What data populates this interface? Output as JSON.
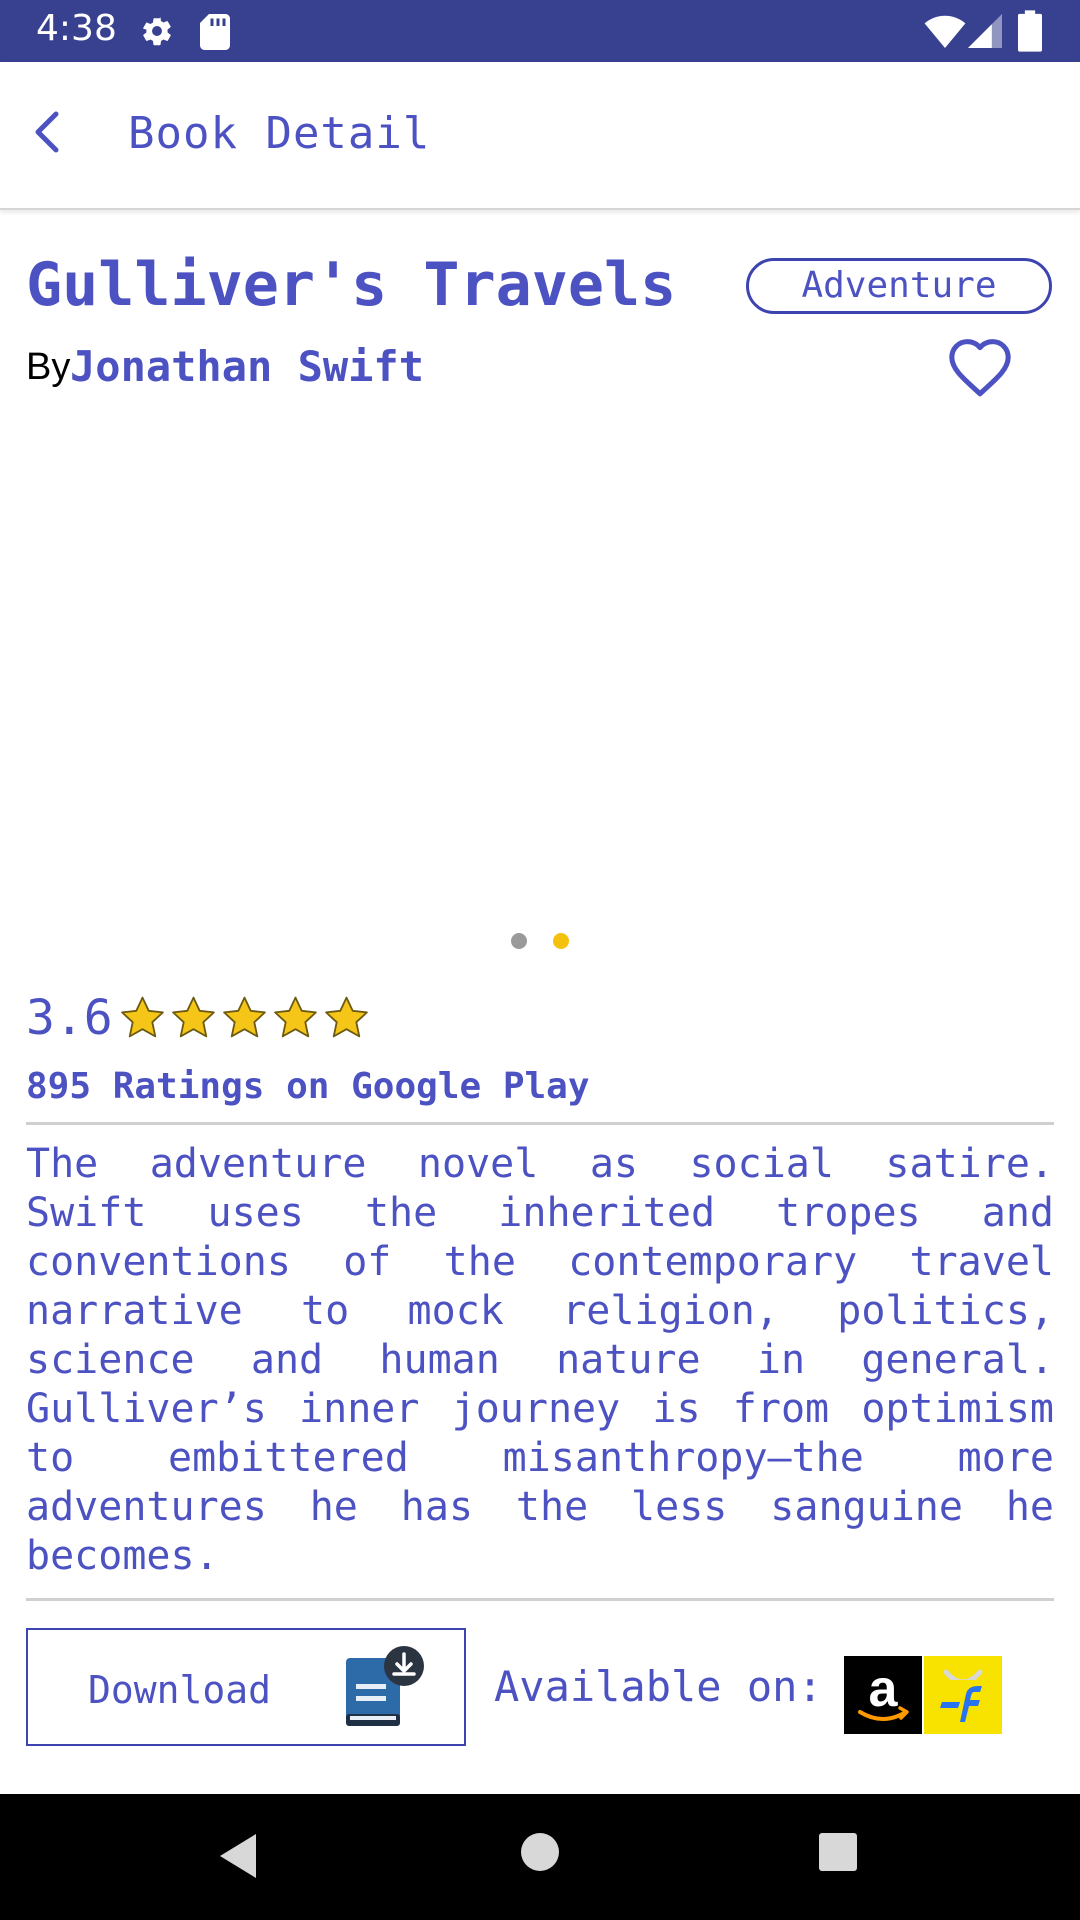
{
  "status_bar": {
    "time": "4:38",
    "background": "#37418f",
    "icons": [
      "settings-icon",
      "sd-card-icon",
      "wifi-icon",
      "signal-icon",
      "battery-icon"
    ]
  },
  "app_bar": {
    "title": "Book Detail",
    "back_icon": "chevron-left-icon"
  },
  "book": {
    "title": "Gulliver's Travels",
    "genre": "Adventure",
    "by_label": "By",
    "author": "Jonathan Swift",
    "favorite_icon": "heart-outline-icon",
    "carousel_pages": 2,
    "carousel_active_page": 2
  },
  "rating": {
    "value": "3.6",
    "stars_shown": 5,
    "count_text": "895 Ratings on Google Play"
  },
  "description": "The adventure novel as social satire. Swift uses the inherited tropes and conventions of the contemporary travel narrative to mock religion, politics, science and human nature in general. Gulliver’s inner journey is from optimism to embittered misanthropy—the more adventures he has the less sanguine he becomes.",
  "actions": {
    "download_label": "Download",
    "available_label": "Available on:",
    "stores": [
      "Amazon",
      "Flipkart"
    ]
  },
  "colors": {
    "accent": "#4c52c2",
    "border": "#3d44b0",
    "active_dot": "#f4c20d",
    "inactive_dot": "#9a9a9a",
    "star": "#f5c518"
  }
}
